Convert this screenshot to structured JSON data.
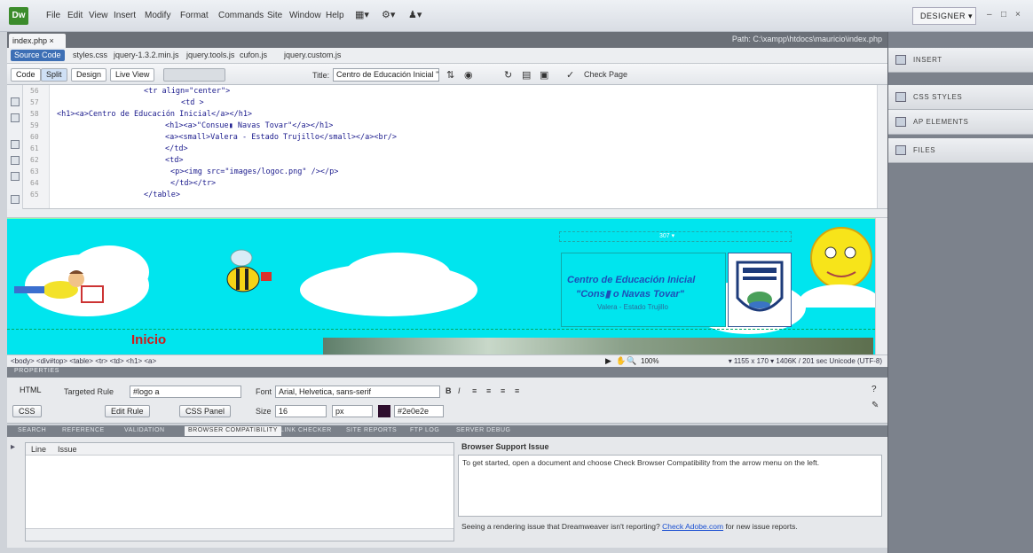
{
  "app": {
    "logo": "Dw",
    "workspace": "DESIGNER ▾",
    "window_controls": [
      "–",
      "□",
      "×"
    ]
  },
  "menu": [
    "File",
    "Edit",
    "View",
    "Insert",
    "Modify",
    "Format",
    "Commands",
    "Site",
    "Window",
    "Help"
  ],
  "document": {
    "tab": "index.php ×",
    "path": "Path: C:\\xampp\\htdocs\\mauricio\\index.php",
    "related_files": [
      "Source Code",
      "styles.css",
      "jquery-1.3.2.min.js",
      "jquery.tools.js",
      "cufon.js",
      "jquery.custom.js"
    ]
  },
  "toolbar": {
    "code": "Code",
    "split": "Split",
    "design": "Design",
    "live_view": "Live View",
    "title_label": "Title:",
    "title_value": "Centro de Educación Inicial \"Co",
    "check_page": "Check Page"
  },
  "code": {
    "line_numbers": [
      "56",
      "57",
      "58",
      "59",
      "60",
      "61",
      "62",
      "63",
      "64",
      "65"
    ],
    "lines": [
      "<tr align=\"center\">",
      "<td >",
      "<h1><a>Centro de Educación Inicial</a></h1>",
      "<h1><a>\"Consue▮ Navas Tovar\"</a></h1>",
      "<a><small>Valera - Estado Trujillo</small></a><br/>",
      "</td>",
      "<td>",
      "<p><img src=\"images/logoc.png\" /></p>",
      "</td></tr>",
      "</table>"
    ]
  },
  "design": {
    "ruler_label": "307 ▾",
    "info_title1": "Centro de Educación Inicial",
    "info_title2": "\"Cons▮ o Navas Tovar\"",
    "info_sub": "Valera - Estado Trujillo",
    "nav_first": "Inicio"
  },
  "status": {
    "tag_path": "<body> <div#top> <table> <tr> <td> <h1> <a>",
    "zoom": "100%",
    "info": "▾ 1155 x 170 ▾ 1406K / 201 sec Unicode (UTF-8)"
  },
  "properties": {
    "header": "PROPERTIES",
    "html_btn": "HTML",
    "css_btn": "CSS",
    "targeted_rule_label": "Targeted Rule",
    "targeted_rule_value": "#logo a",
    "edit_rule": "Edit Rule",
    "css_panel": "CSS Panel",
    "font_label": "Font",
    "font_value": "Arial, Helvetica, sans-serif",
    "size_label": "Size",
    "size_value": "16",
    "size_unit": "px",
    "color_value": "#2e0e2e",
    "color_hex": "#2e0e2e"
  },
  "results": {
    "tabs": [
      "SEARCH",
      "REFERENCE",
      "VALIDATION",
      "BROWSER COMPATIBILITY",
      "LINK CHECKER",
      "SITE REPORTS",
      "FTP LOG",
      "SERVER DEBUG"
    ],
    "active_tab": "BROWSER COMPATIBILITY",
    "col_line": "Line",
    "col_issue": "Issue",
    "support_title": "Browser Support Issue",
    "support_msg": "To get started, open a document and choose Check Browser Compatibility from the arrow menu on the left.",
    "footer_msg": "Seeing a rendering issue that Dreamweaver isn't reporting?",
    "footer_link": "Check Adobe.com",
    "footer_tail": "for new issue reports."
  },
  "panels": [
    "INSERT",
    "CSS STYLES",
    "AP ELEMENTS",
    "FILES"
  ]
}
